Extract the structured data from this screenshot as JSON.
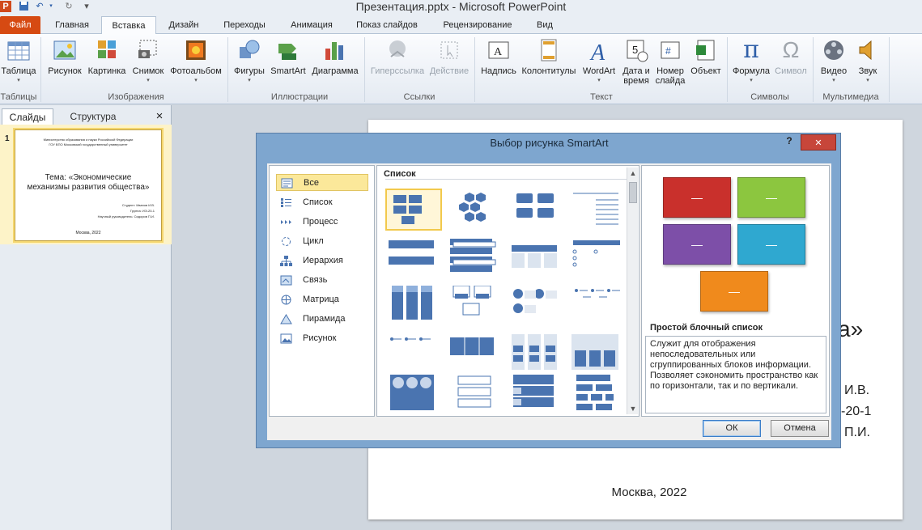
{
  "window": {
    "title": "Презентация.pptx - Microsoft PowerPoint",
    "app_badge": "P"
  },
  "tabs": [
    {
      "label": "Файл"
    },
    {
      "label": "Главная"
    },
    {
      "label": "Вставка"
    },
    {
      "label": "Дизайн"
    },
    {
      "label": "Переходы"
    },
    {
      "label": "Анимация"
    },
    {
      "label": "Показ слайдов"
    },
    {
      "label": "Рецензирование"
    },
    {
      "label": "Вид"
    }
  ],
  "ribbon": {
    "buttons": [
      "Таблица",
      "Рисунок",
      "Картинка",
      "Снимок",
      "Фотоальбом",
      "Фигуры",
      "SmartArt",
      "Диаграмма",
      "Гиперссылка",
      "Действие",
      "Надпись",
      "Колонтитулы",
      "WordArt",
      "Дата и",
      "время",
      "Номер",
      "слайда",
      "Объект",
      "Формула",
      "Символ",
      "Видео",
      "Звук"
    ],
    "groups": [
      "Таблицы",
      "Изображения",
      "Иллюстрации",
      "Ссылки",
      "Текст",
      "Символы",
      "Мультимедиа"
    ]
  },
  "left_panel": {
    "tabs": [
      "Слайды",
      "Структура"
    ],
    "close": "×",
    "slide_number": "1",
    "thumb": {
      "header1": "Министерство образования и науки Российской Федерации",
      "header2": "ГОУ ВПО Московский государственный университет",
      "title1": "Тема: «Экономические",
      "title2": "механизмы развития общества»",
      "info1": "Студент: Иванов И.В.",
      "info2": "Группа: ИЭ-20-1",
      "info3": "Научный руководитель: Сидоров П.И.",
      "footer": "Москва, 2022"
    }
  },
  "slide": {
    "frag_title": "а»",
    "frag1": "И.В.",
    "frag2": "-20-1",
    "frag3": "П.И.",
    "footer": "Москва, 2022"
  },
  "dialog": {
    "title": "Выбор рисунка SmartArt",
    "help": "?",
    "close": "✕",
    "categories": [
      "Все",
      "Список",
      "Процесс",
      "Цикл",
      "Иерархия",
      "Связь",
      "Матрица",
      "Пирамида",
      "Рисунок"
    ],
    "gallery_header": "Список",
    "preview_title": "Простой блочный список",
    "preview_desc": "Служит для отображения непоследовательных или сгруппированных блоков информации. Позволяет сэкономить пространство как по горизонтали, так и по вертикали.",
    "ok": "ОК",
    "cancel": "Отмена",
    "colors": {
      "red": "#c9302c",
      "green": "#8cc63f",
      "purple": "#7d4fa8",
      "cyan": "#2fa8d0",
      "orange": "#f08a1c"
    }
  }
}
